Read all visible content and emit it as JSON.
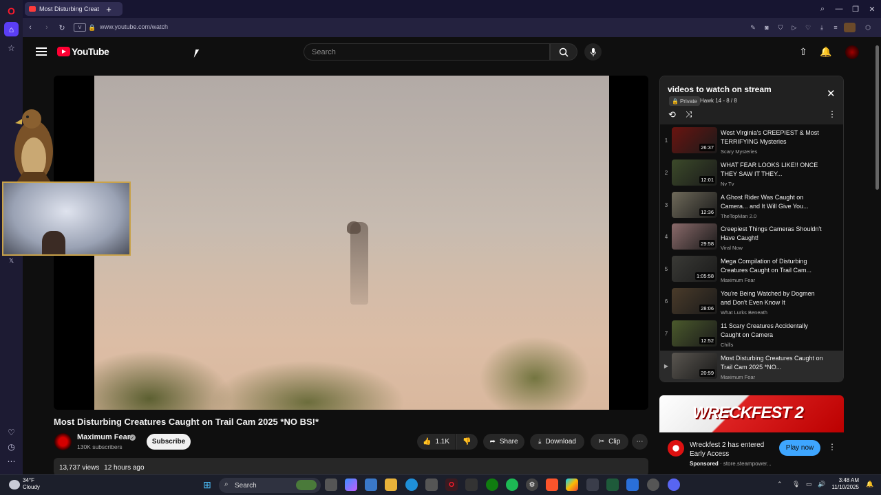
{
  "browser": {
    "tab_title": "Most Disturbing Creat",
    "url": "www.youtube.com/watch"
  },
  "youtube": {
    "logo_text": "YouTube",
    "search_placeholder": "Search"
  },
  "video": {
    "title": "Most Disturbing Creatures Caught on Trail Cam 2025 *NO BS!*",
    "channel": "Maximum Fear",
    "subscribers": "130K subscribers",
    "subscribe_label": "Subscribe",
    "likes": "1.1K",
    "share_label": "Share",
    "download_label": "Download",
    "clip_label": "Clip",
    "views": "13,737 views",
    "age": "12 hours ago"
  },
  "playlist": {
    "title": "videos to watch on stream",
    "privacy": "Private",
    "owner": "Hawk 14 - 8 / 8",
    "items": [
      {
        "index": "1",
        "title": "West Virginia's CREEPIEST & Most TERRIFYING Mysteries",
        "channel": "Scary Mysteries",
        "duration": "26:37",
        "thumb": "#6a1410"
      },
      {
        "index": "2",
        "title": "WHAT FEAR LOOKS LIKE!! ONCE THEY SAW IT THEY...",
        "channel": "Nv Tv",
        "duration": "12:01",
        "thumb": "#3c4a2a"
      },
      {
        "index": "3",
        "title": "A Ghost Rider Was Caught on Camera... and It Will Give You...",
        "channel": "TheTopMan 2.0",
        "duration": "12:36",
        "thumb": "#6f6a5a"
      },
      {
        "index": "4",
        "title": "Creepiest Things Cameras Shouldn't Have Caught!",
        "channel": "Viral Now",
        "duration": "29:58",
        "thumb": "#8a6a6a"
      },
      {
        "index": "5",
        "title": "Mega Compilation of Disturbing Creatures Caught on Trail Cam...",
        "channel": "Maximum Fear",
        "duration": "1:05:58",
        "thumb": "#3a3a36"
      },
      {
        "index": "6",
        "title": "You're Being Watched by Dogmen and Don't Even Know It",
        "channel": "What Lurks Beneath",
        "duration": "28:06",
        "thumb": "#4a3b2a"
      },
      {
        "index": "7",
        "title": "11 Scary Creatures Accidentally Caught on Camera",
        "channel": "Chills",
        "duration": "12:52",
        "thumb": "#4b5a2c"
      },
      {
        "index": "▶",
        "title": "Most Disturbing Creatures Caught on Trail Cam 2025 *NO...",
        "channel": "Maximum Fear",
        "duration": "20:59",
        "thumb": "#5a5650"
      }
    ]
  },
  "ad": {
    "banner_text": "WRECKFEST 2",
    "headline": "Wreckfest 2 has entered Early Access",
    "sponsored": "Sponsored",
    "domain": "store.steampower...",
    "cta": "Play now"
  },
  "taskbar": {
    "temperature": "34°F",
    "condition": "Cloudy",
    "search": "Search",
    "time": "3:48 AM",
    "date": "11/10/2025"
  },
  "colors": {
    "youtube_red": "#ff0033",
    "link_blue": "#3ea6ff",
    "opera_purple": "#1d1b33"
  }
}
